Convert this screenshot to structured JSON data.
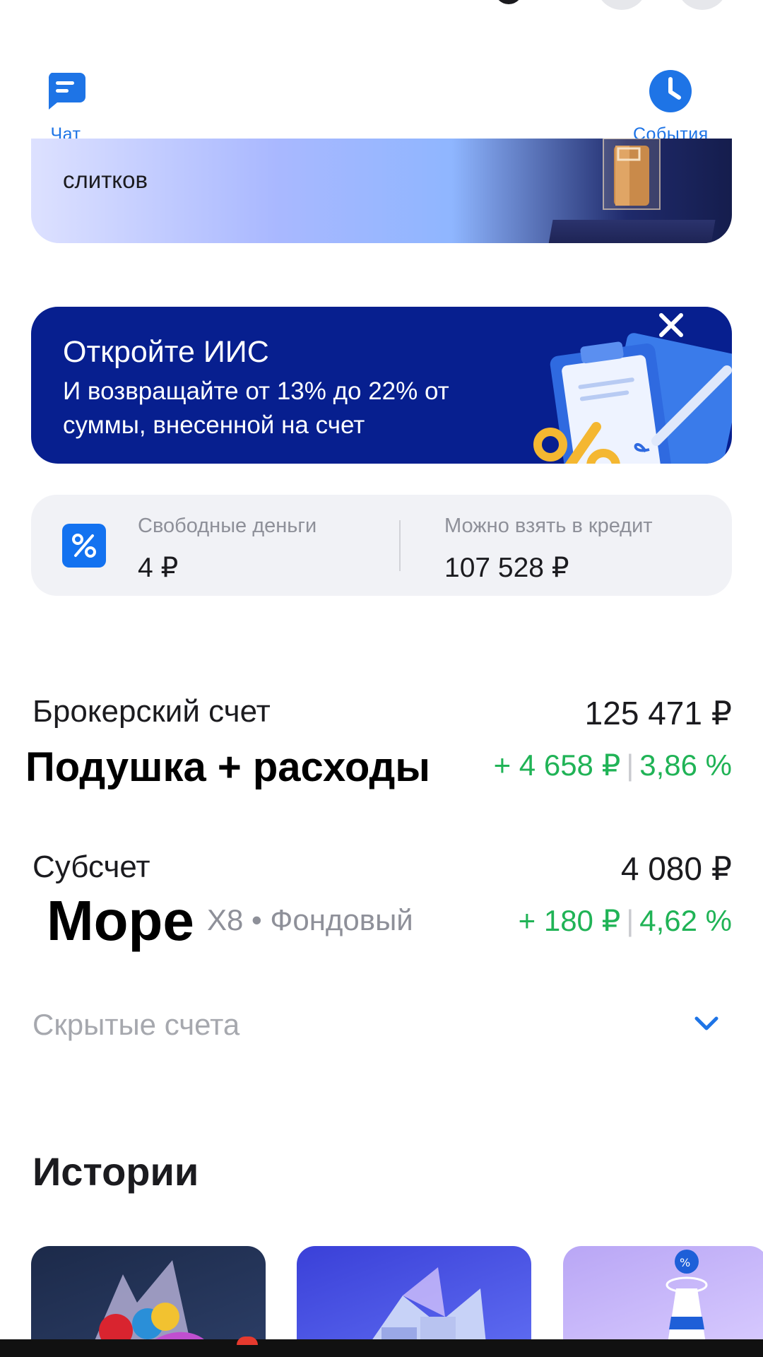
{
  "header": {
    "chat_label": "Чат",
    "events_label": "События"
  },
  "gold_banner": {
    "text": "слитков"
  },
  "iis_banner": {
    "title": "Откройте ИИС",
    "subtitle": "И возвращайте от 13% до 22% от суммы, внесенной на счет"
  },
  "money_card": {
    "free_label": "Свободные деньги",
    "free_value": "4 ₽",
    "credit_label": "Можно взять в кредит",
    "credit_value": "107 528 ₽"
  },
  "accounts": [
    {
      "name": "Брокерский счет",
      "amount": "125 471 ₽",
      "subtitle": "Подушка + расходы",
      "change_abs": "+ 4 658 ₽",
      "change_pct": "3,86 %"
    },
    {
      "name": "Субсчет",
      "amount": "4 080 ₽",
      "overlay": "Море",
      "type_text": "X8 • Фондовый",
      "change_abs": "+ 180 ₽",
      "change_pct": "4,62 %"
    }
  ],
  "hidden_accounts_label": "Скрытые счета",
  "stories_title": "Истории",
  "colors": {
    "accent_blue": "#1e74e6",
    "iis_bg": "#071f8f",
    "positive_green": "#20b356"
  },
  "icons": {
    "chat": "chat-bubble-icon",
    "events": "clock-icon",
    "close": "close-icon",
    "percent": "percent-icon",
    "chevron": "chevron-down-icon"
  }
}
